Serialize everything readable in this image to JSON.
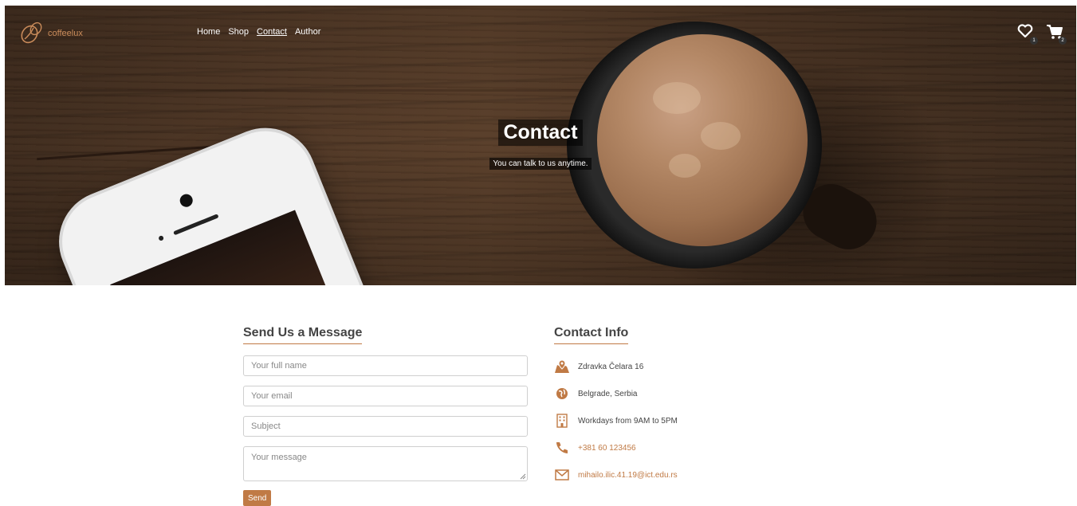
{
  "brand": {
    "name": "coffeelux",
    "accent": "#c07a45"
  },
  "nav": {
    "items": [
      {
        "label": "Home"
      },
      {
        "label": "Shop"
      },
      {
        "label": "Contact"
      },
      {
        "label": "Author"
      }
    ],
    "active": "Contact",
    "wishlist_count": "1",
    "cart_count": "2"
  },
  "hero": {
    "title": "Contact",
    "subtitle": "You can talk to us anytime."
  },
  "form": {
    "title": "Send Us a Message",
    "name_placeholder": "Your full name",
    "email_placeholder": "Your email",
    "subject_placeholder": "Subject",
    "message_placeholder": "Your message",
    "send_label": "Send"
  },
  "info": {
    "title": "Contact Info",
    "address": "Zdravka Čelara 16",
    "city": "Belgrade, Serbia",
    "hours": "Workdays from 9AM to 5PM",
    "phone": "+381 60 123456",
    "email": "mihailo.ilic.41.19@ict.edu.rs"
  }
}
